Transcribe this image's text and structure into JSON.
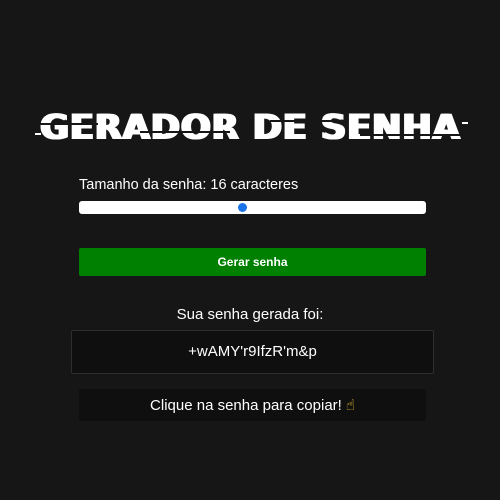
{
  "app": {
    "title": "GERADOR DE SENHA"
  },
  "length": {
    "label": "Tamanho da senha:",
    "value": "16",
    "unit": "caracteres",
    "slider_fraction": 0.47
  },
  "generate_button": {
    "label": "Gerar senha"
  },
  "result": {
    "label": "Sua senha gerada foi:",
    "password": "+wAMY'r9IfzR'm&p"
  },
  "copy_hint": {
    "label": "Clique na senha para copiar!",
    "icon": "pointing-hand-icon"
  },
  "colors": {
    "background": "#161616",
    "button": "#008000",
    "slider_thumb": "#1a73e8",
    "panel": "#0f0f0f"
  }
}
